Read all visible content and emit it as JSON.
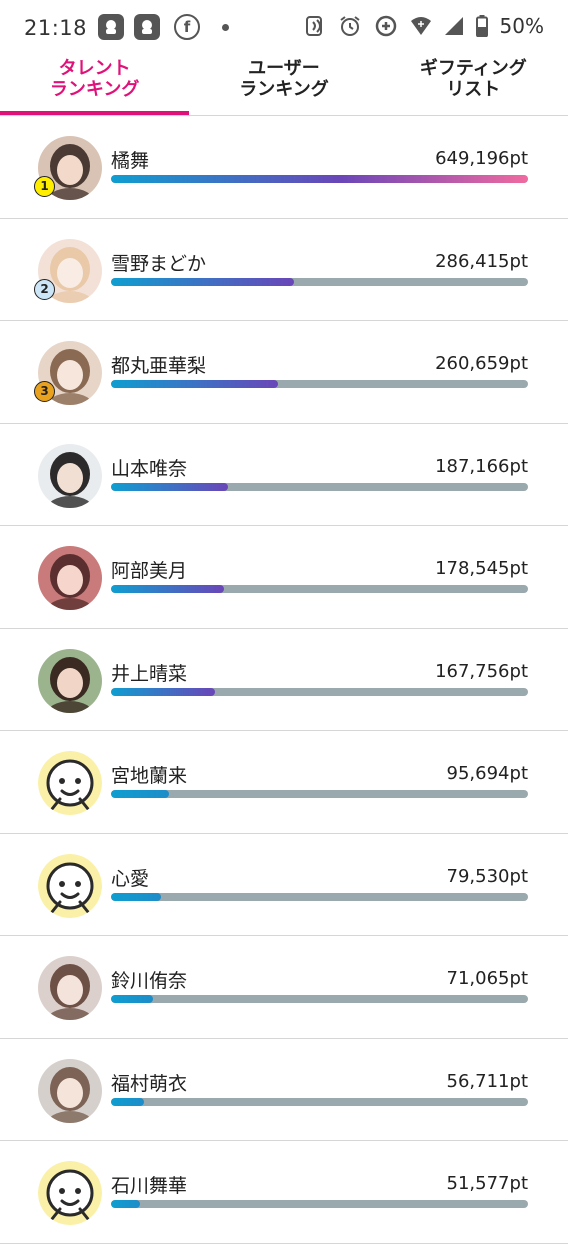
{
  "status_bar": {
    "time": "21:18",
    "battery": "50%"
  },
  "tabs": [
    {
      "line1": "タレント",
      "line2": "ランキング",
      "active": true
    },
    {
      "line1": "ユーザー",
      "line2": "ランキング",
      "active": false
    },
    {
      "line1": "ギフティング",
      "line2": "リスト",
      "active": false
    }
  ],
  "colors": {
    "accent": "#e0127a",
    "bar_track": "#9aa9ad",
    "bar_start": "#0f9ed0",
    "bar_mid": "#6a46b8",
    "bar_end": "#f06aa0",
    "rank1": "#ffee00",
    "rank2": "#cde6f7",
    "rank3": "#e9a21d",
    "default_avatar_bg": "#fbf0a8"
  },
  "ranking": [
    {
      "rank": "1",
      "name": "橘舞",
      "points": "649,196pt",
      "progress": 1.0,
      "avatar": "photo-avatar"
    },
    {
      "rank": "2",
      "name": "雪野まどか",
      "points": "286,415pt",
      "progress": 0.44,
      "avatar": "photo-avatar"
    },
    {
      "rank": "3",
      "name": "都丸亜華梨",
      "points": "260,659pt",
      "progress": 0.4,
      "avatar": "photo-avatar"
    },
    {
      "rank": "",
      "name": "山本唯奈",
      "points": "187,166pt",
      "progress": 0.28,
      "avatar": "photo-avatar"
    },
    {
      "rank": "",
      "name": "阿部美月",
      "points": "178,545pt",
      "progress": 0.27,
      "avatar": "photo-avatar"
    },
    {
      "rank": "",
      "name": "井上晴菜",
      "points": "167,756pt",
      "progress": 0.25,
      "avatar": "photo-avatar"
    },
    {
      "rank": "",
      "name": "宮地蘭来",
      "points": "95,694pt",
      "progress": 0.14,
      "avatar": "default-face-icon"
    },
    {
      "rank": "",
      "name": "心愛",
      "points": "79,530pt",
      "progress": 0.12,
      "avatar": "default-face-icon"
    },
    {
      "rank": "",
      "name": "鈴川侑奈",
      "points": "71,065pt",
      "progress": 0.1,
      "avatar": "photo-avatar"
    },
    {
      "rank": "",
      "name": "福村萌衣",
      "points": "56,711pt",
      "progress": 0.08,
      "avatar": "photo-avatar"
    },
    {
      "rank": "",
      "name": "石川舞華",
      "points": "51,577pt",
      "progress": 0.07,
      "avatar": "default-face-icon"
    }
  ]
}
